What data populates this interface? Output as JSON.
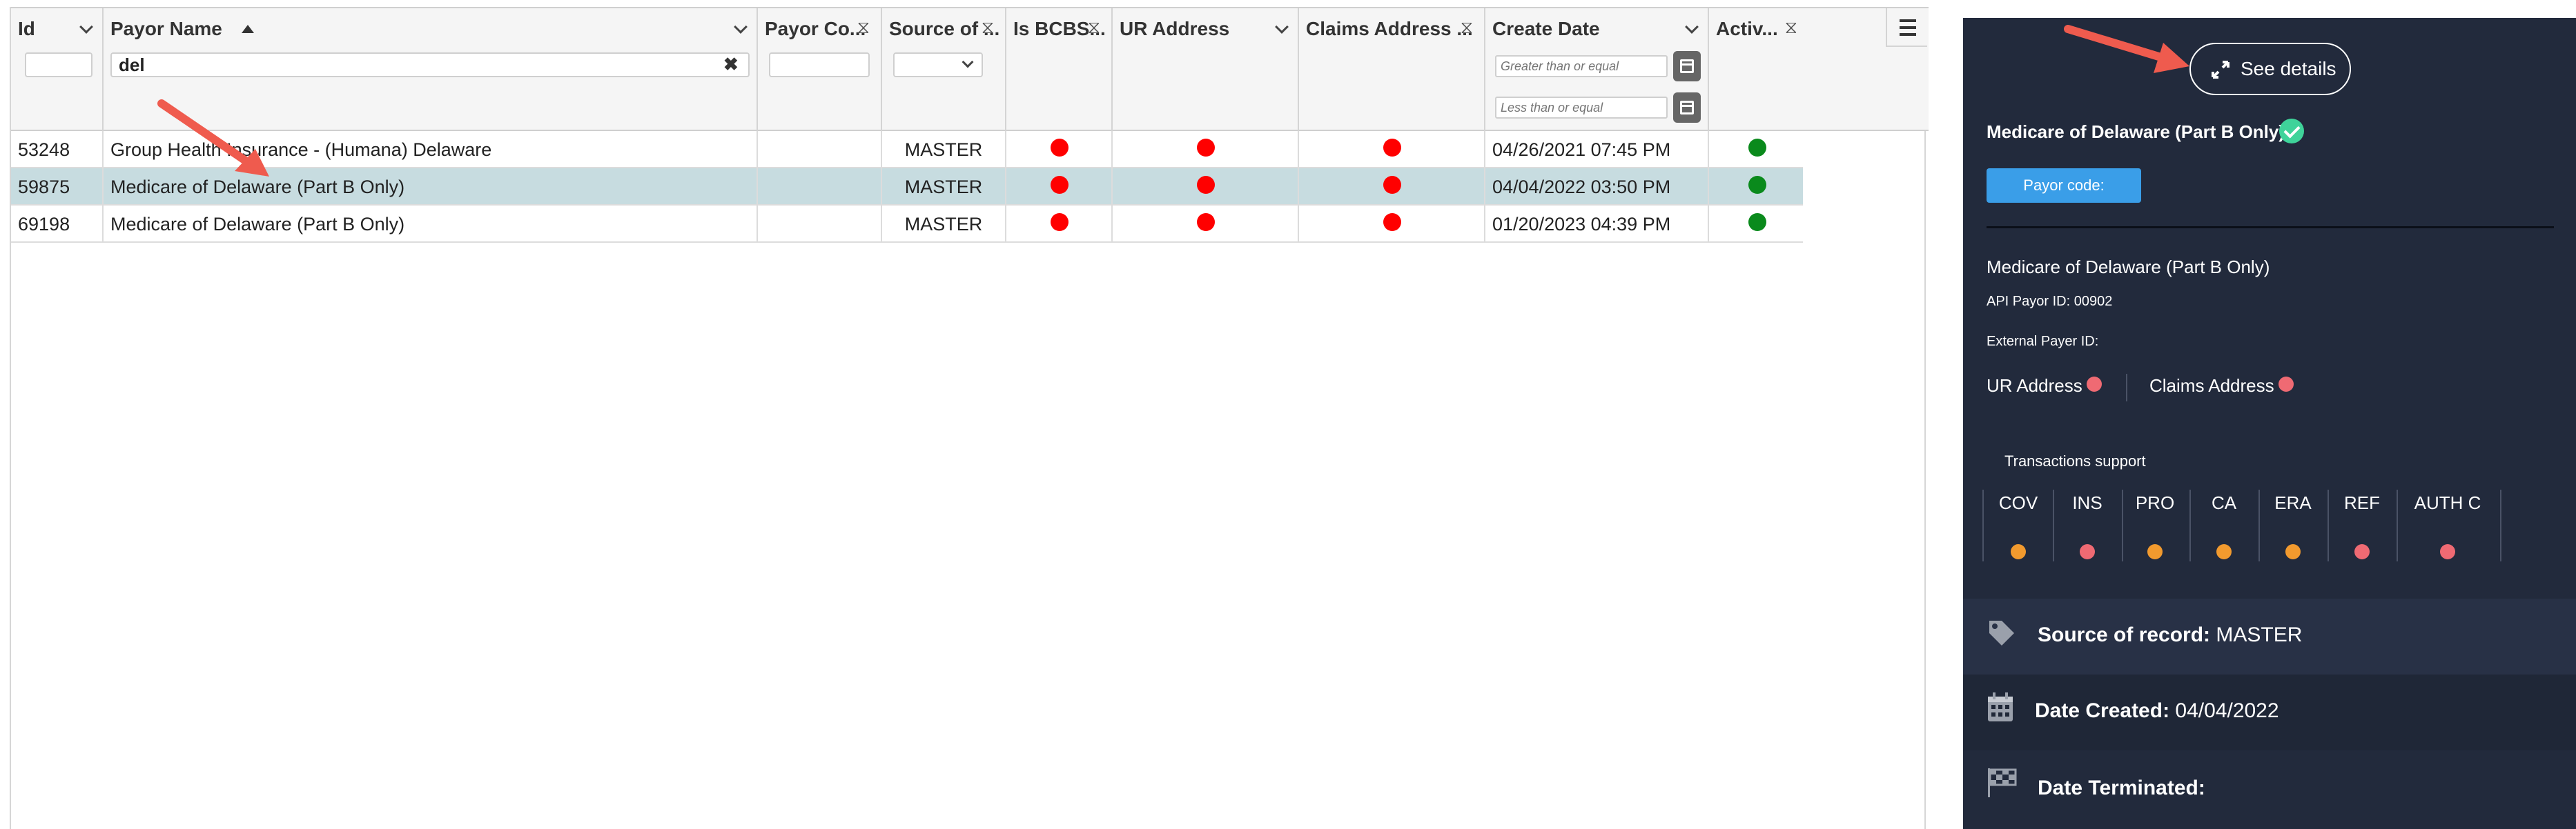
{
  "grid": {
    "columns": [
      {
        "id": "id",
        "title": "Id"
      },
      {
        "id": "payor_name",
        "title": "Payor Name"
      },
      {
        "id": "payor_code",
        "title": "Payor Co..."
      },
      {
        "id": "source",
        "title": "Source of ..."
      },
      {
        "id": "is_bcbs",
        "title": "Is BCBS..."
      },
      {
        "id": "ur_address",
        "title": "UR Address"
      },
      {
        "id": "claims_address",
        "title": "Claims Address ..."
      },
      {
        "id": "create_date",
        "title": "Create Date"
      },
      {
        "id": "active",
        "title": "Activ..."
      }
    ],
    "filters": {
      "payor_name_value": "del",
      "date_from_placeholder": "Greater than or equal",
      "date_to_placeholder": "Less than or equal"
    },
    "rows": [
      {
        "id": "53248",
        "payor_name": "Group Health Insurance - (Humana) Delaware",
        "payor_code": "",
        "source": "MASTER",
        "is_bcbs": "red",
        "ur_address": "red",
        "claims_address": "red",
        "create_date": "04/26/2021 07:45 PM",
        "active": "green",
        "selected": false
      },
      {
        "id": "59875",
        "payor_name": "Medicare of Delaware (Part B Only)",
        "payor_code": "",
        "source": "MASTER",
        "is_bcbs": "red",
        "ur_address": "red",
        "claims_address": "red",
        "create_date": "04/04/2022 03:50 PM",
        "active": "green",
        "selected": true
      },
      {
        "id": "69198",
        "payor_name": "Medicare of Delaware (Part B Only)",
        "payor_code": "",
        "source": "MASTER",
        "is_bcbs": "red",
        "ur_address": "red",
        "claims_address": "red",
        "create_date": "01/20/2023 04:39 PM",
        "active": "green",
        "selected": false
      }
    ]
  },
  "panel": {
    "see_details_label": "See details",
    "title": "Medicare of Delaware (Part B Only)",
    "payor_code_label": "Payor code:",
    "name": "Medicare of Delaware (Part B Only)",
    "api_payor_id": "API Payor ID: 00902",
    "external_payer_id": "External Payer ID:",
    "ur_address_label": "UR Address",
    "claims_address_label": "Claims Address",
    "transactions_label": "Transactions support",
    "transactions": [
      {
        "code": "COV",
        "status": "orange"
      },
      {
        "code": "INS",
        "status": "pink"
      },
      {
        "code": "PRO",
        "status": "orange"
      },
      {
        "code": "CA",
        "status": "orange"
      },
      {
        "code": "ERA",
        "status": "orange"
      },
      {
        "code": "REF",
        "status": "pink"
      },
      {
        "code": "AUTH C",
        "status": "pink"
      }
    ],
    "source_label": "Source of record:",
    "source_value": "MASTER",
    "created_label": "Date Created:",
    "created_value": "04/04/2022",
    "terminated_label": "Date Terminated:"
  },
  "colors": {
    "red": "#ff0000",
    "green": "#0a8a1c",
    "orange": "#f29a2e",
    "pink": "#ef6a73",
    "panel_bg": "#222a3c",
    "selected_row": "#c7dce0",
    "accent_blue": "#3a9ee8"
  }
}
